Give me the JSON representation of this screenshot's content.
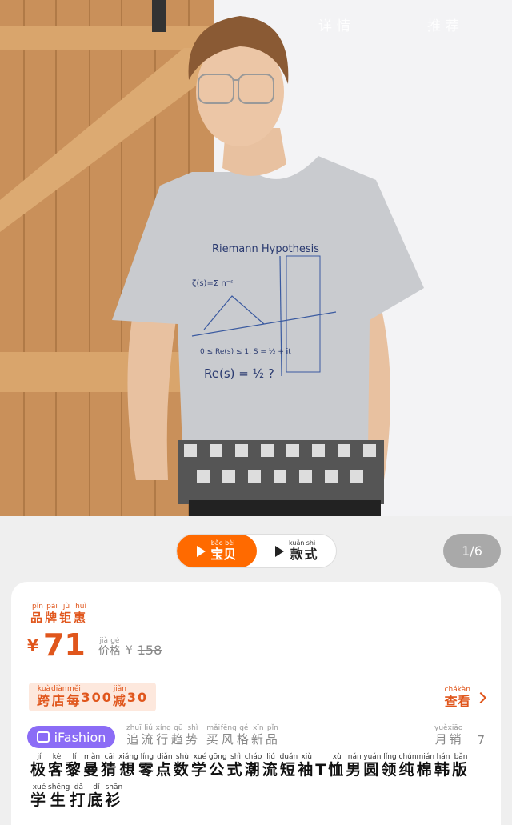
{
  "header": {
    "tabs": [
      "详情",
      "推荐"
    ]
  },
  "gallery": {
    "shirt_title": "Riemann Hypothesis",
    "shirt_formula_1": "ζ(s)=Σ n⁻ˢ",
    "shirt_formula_2": "0 ≤ Re(s) ≤ 1, S = ½ + it",
    "shirt_formula_3": "Re(s) = ½ ?",
    "counter": "1/6"
  },
  "switcher": {
    "items": [
      {
        "label": "宝贝",
        "pinyin": [
          "bǎo",
          "bèi"
        ]
      },
      {
        "label": "款式",
        "pinyin": [
          "kuǎn",
          "shì"
        ]
      }
    ]
  },
  "product": {
    "brand_tag": "品牌钜惠",
    "brand_pinyin": [
      "pǐn",
      "pái",
      "jù",
      "huì"
    ],
    "currency": "¥",
    "price": "71",
    "price_label": "价格",
    "price_label_pinyin": [
      "jià",
      "gé"
    ],
    "original_price": "158",
    "promo": {
      "prefix": "跨店每",
      "amount": "300",
      "mid": "减",
      "discount": "30",
      "pinyin": [
        "kuà",
        "diàn",
        "měi",
        "jiǎn"
      ]
    },
    "view_more": "查看",
    "view_more_pinyin": [
      "chá",
      "kàn"
    ],
    "badge": "iFashion",
    "trend_text": "追流行趋势 买风格新品",
    "sales_label": "月销",
    "sales_pinyin": [
      "yuè",
      "xiāo"
    ],
    "sales_count": "7",
    "title": "极客黎曼猜想零点数学公式潮流短袖T恤男圆领纯棉韩版学生打底衫"
  },
  "colors": {
    "accent": "#e0561c",
    "orange": "#ff6a00",
    "badge": "#8b6cf6"
  }
}
